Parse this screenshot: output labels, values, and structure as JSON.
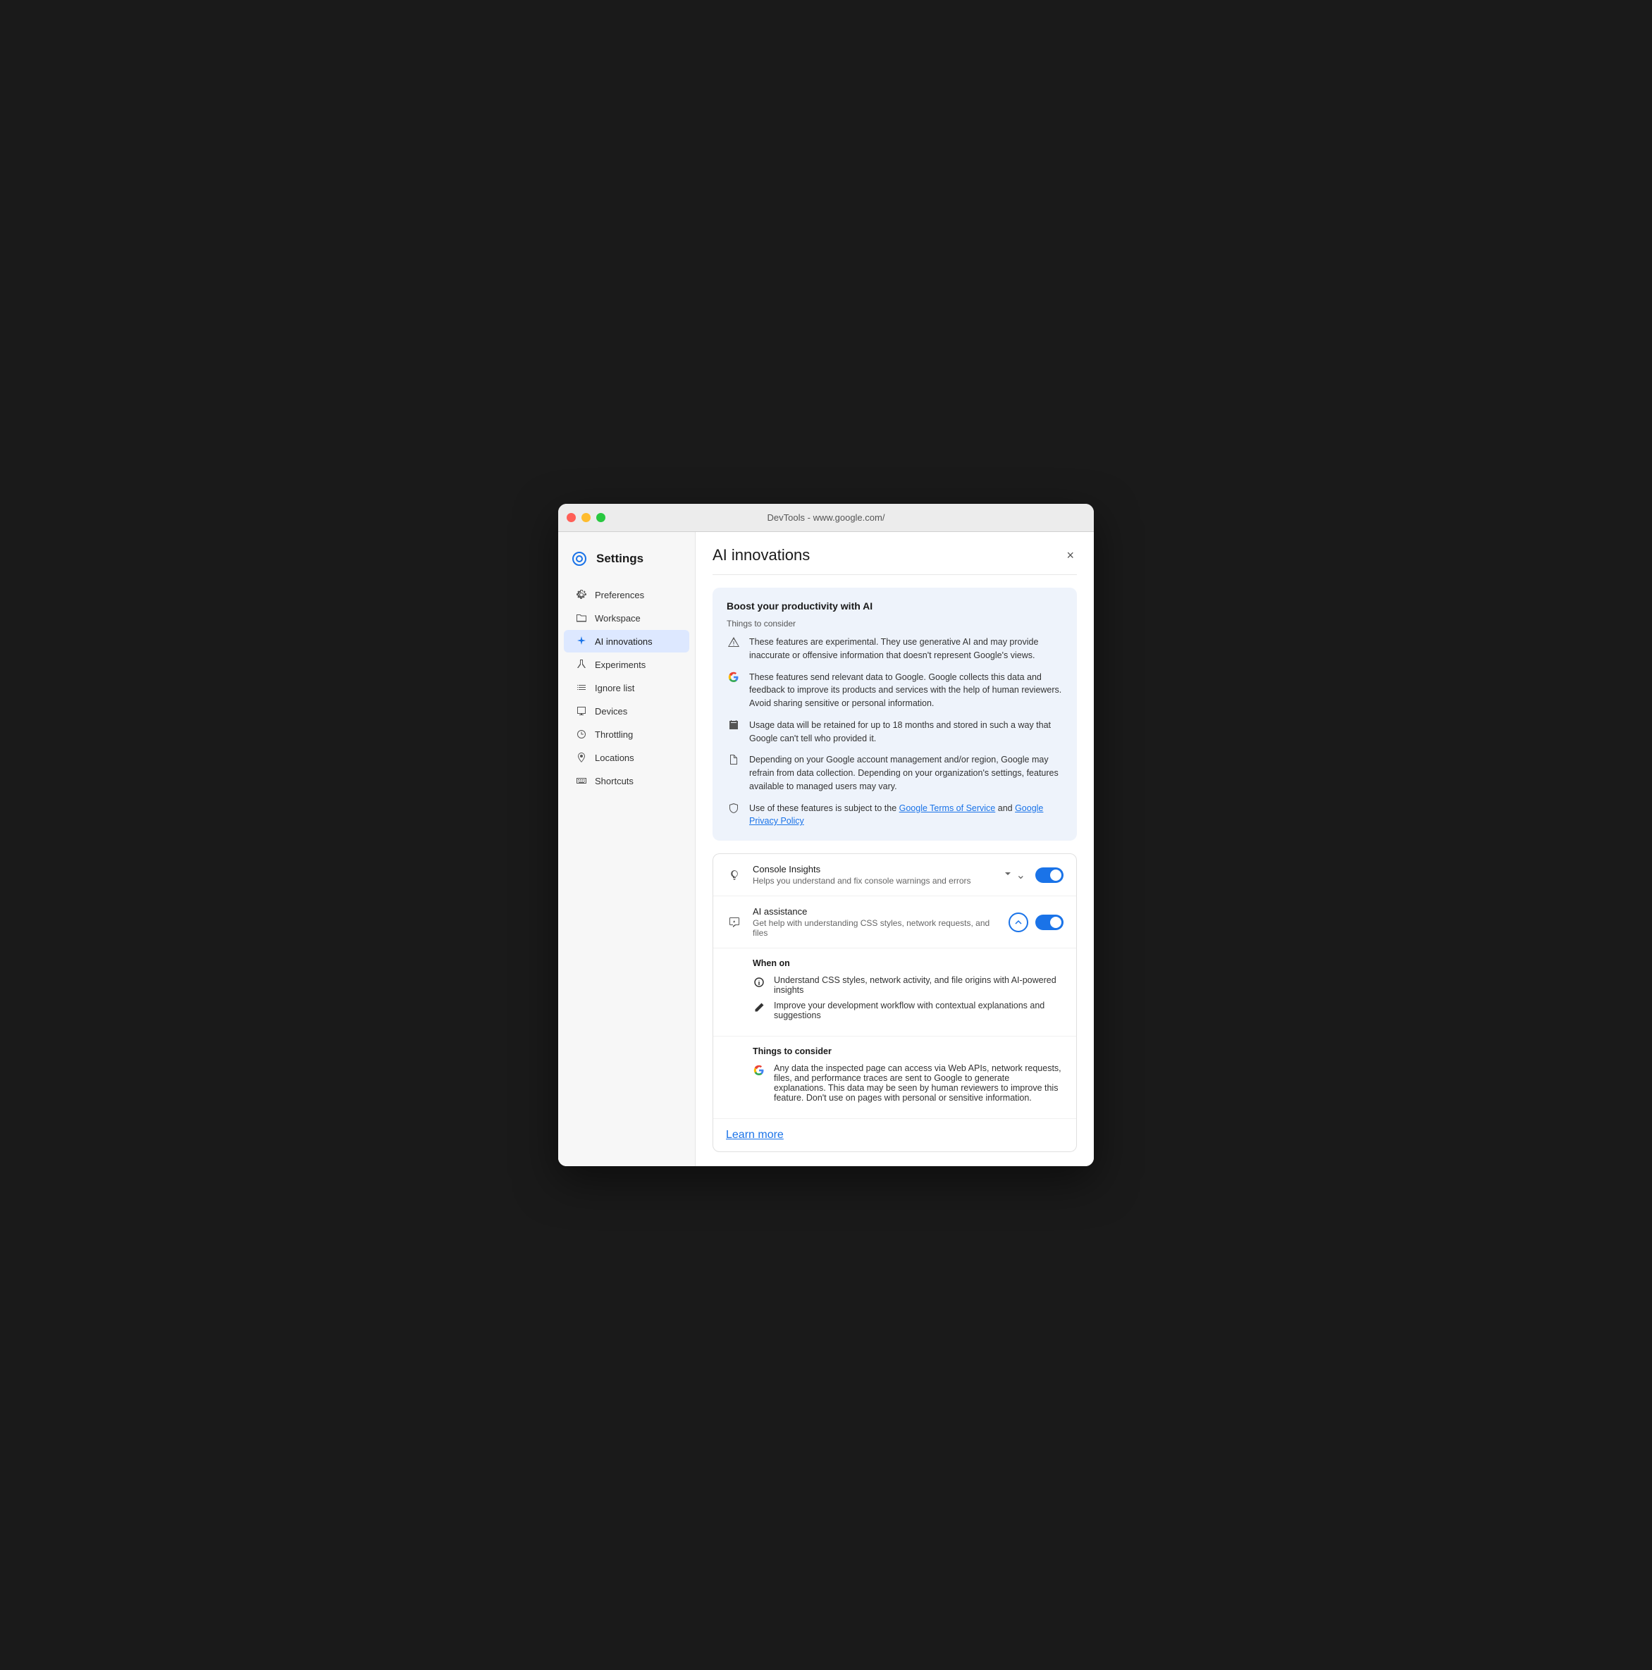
{
  "window": {
    "title": "DevTools - www.google.com/"
  },
  "sidebar": {
    "app_icon_label": "settings-app-icon",
    "title": "Settings",
    "items": [
      {
        "id": "preferences",
        "label": "Preferences",
        "icon": "gear"
      },
      {
        "id": "workspace",
        "label": "Workspace",
        "icon": "folder"
      },
      {
        "id": "ai-innovations",
        "label": "AI innovations",
        "icon": "sparkle",
        "active": true
      },
      {
        "id": "experiments",
        "label": "Experiments",
        "icon": "flask"
      },
      {
        "id": "ignore-list",
        "label": "Ignore list",
        "icon": "list"
      },
      {
        "id": "devices",
        "label": "Devices",
        "icon": "device"
      },
      {
        "id": "throttling",
        "label": "Throttling",
        "icon": "gauge"
      },
      {
        "id": "locations",
        "label": "Locations",
        "icon": "pin"
      },
      {
        "id": "shortcuts",
        "label": "Shortcuts",
        "icon": "keyboard"
      }
    ]
  },
  "main": {
    "title": "AI innovations",
    "close_label": "×",
    "info_box": {
      "title": "Boost your productivity with AI",
      "subtitle": "Things to consider",
      "items": [
        {
          "icon": "warning",
          "text": "These features are experimental. They use generative AI and may provide inaccurate or offensive information that doesn't represent Google's views."
        },
        {
          "icon": "google",
          "text": "These features send relevant data to Google. Google collects this data and feedback to improve its products and services with the help of human reviewers. Avoid sharing sensitive or personal information."
        },
        {
          "icon": "calendar",
          "text": "Usage data will be retained for up to 18 months and stored in such a way that Google can't tell who provided it."
        },
        {
          "icon": "document",
          "text": "Depending on your Google account management and/or region, Google may refrain from data collection. Depending on your organization's settings, features available to managed users may vary."
        },
        {
          "icon": "shield",
          "text_before": "Use of these features is subject to the ",
          "link1": "Google Terms of Service",
          "text_mid": " and ",
          "link2": "Google Privacy Policy",
          "text_after": ""
        }
      ]
    },
    "features": [
      {
        "id": "console-insights",
        "icon": "lightbulb",
        "title": "Console Insights",
        "desc": "Helps you understand and fix console warnings and errors",
        "toggle": true,
        "expanded": false,
        "chevron": "down"
      },
      {
        "id": "ai-assistance",
        "icon": "ai-chat",
        "title": "AI assistance",
        "desc": "Get help with understanding CSS styles, network requests, and files",
        "toggle": true,
        "expanded": true,
        "chevron": "up"
      }
    ],
    "when_on": {
      "title": "When on",
      "items": [
        {
          "icon": "info",
          "text": "Understand CSS styles, network activity, and file origins with AI-powered insights"
        },
        {
          "icon": "pencil",
          "text": "Improve your development workflow with contextual explanations and suggestions"
        }
      ]
    },
    "things_to_consider": {
      "title": "Things to consider",
      "items": [
        {
          "icon": "google",
          "text": "Any data the inspected page can access via Web APIs, network requests, files, and performance traces are sent to Google to generate explanations. This data may be seen by human reviewers to improve this feature. Don't use on pages with personal or sensitive information."
        }
      ]
    },
    "learn_more": "Learn more"
  }
}
